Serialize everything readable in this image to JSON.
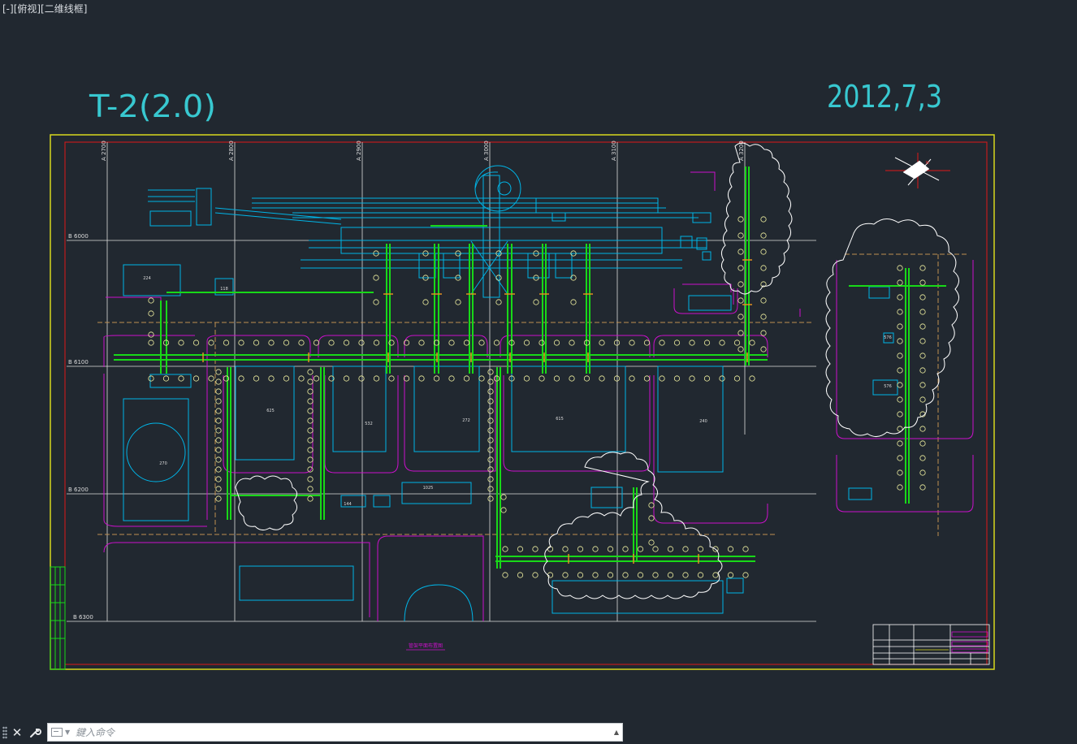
{
  "viewport": {
    "label": "[-][俯视][二维线框]"
  },
  "drawing": {
    "annotation_left": "T-2(2.0)",
    "annotation_right": "2012,7,3",
    "grid_a": [
      "A 2700",
      "A 2800",
      "A 2900",
      "A 3000",
      "A 3100",
      "A 3200"
    ],
    "grid_b": [
      "B 6000",
      "B 6100",
      "B 6200",
      "B 6300"
    ],
    "room_values": [
      "224",
      "118",
      "270",
      "625",
      "532",
      "272",
      "615",
      "240",
      "1025",
      "144",
      "576",
      "576"
    ],
    "plan_title": "管架平面布置图",
    "colors": {
      "frame": "#d8d81e",
      "border": "#e01818",
      "grid": "#dcdcdc",
      "building": "#00b4e6",
      "road": "#cc10cc",
      "pipe": "#18d818",
      "cloud": "#ffffff",
      "dash": "#c09050",
      "accent": "#38c8d0"
    }
  },
  "command_line": {
    "placeholder": "鍵入命令",
    "close_icon": "close-icon",
    "customize_icon": "wrench-icon",
    "prompt_icon": "terminal-icon",
    "history_icon": "caret-up-icon"
  }
}
